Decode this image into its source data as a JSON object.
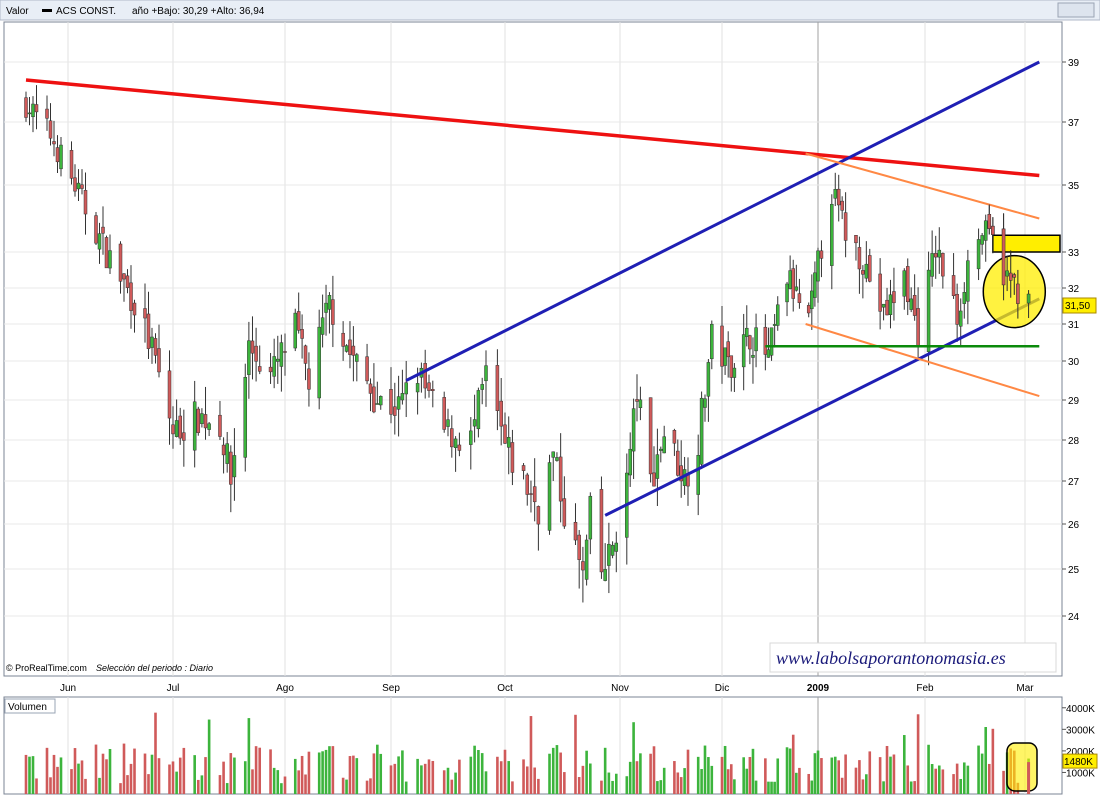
{
  "header": {
    "label": "Valor",
    "ticker": "ACS CONST.",
    "range_text": "año +Bajo: 30,29 +Alto: 36,94"
  },
  "footer": {
    "credit": "© ProRealTime.com",
    "period": "Selección del periodo : Diario",
    "watermark": "www.labolsaporantonomasia.es"
  },
  "volume_panel": {
    "label": "Volumen",
    "yticks": [
      "4000K",
      "3000K",
      "2000K",
      "1000K"
    ],
    "last_label": "1480K"
  },
  "colors": {
    "up": "#3cb43c",
    "down": "#d05a5a",
    "resistance": "#ee1111",
    "channel": "#1f1fb4",
    "fan": "#ff8844",
    "support": "#0b8a0b",
    "highlight": "#ffee00"
  },
  "chart_data": {
    "type": "candlestick",
    "title": "ACS CONST.",
    "x_months": [
      "Jun",
      "Jul",
      "Ago",
      "Sep",
      "Oct",
      "Nov",
      "Dic",
      "2009",
      "Feb",
      "Mar"
    ],
    "y_ticks": [
      24,
      25,
      26,
      27,
      28,
      29,
      30,
      31,
      32,
      33,
      35,
      37,
      39
    ],
    "ylim": [
      23,
      40
    ],
    "last_price": "31,50",
    "period": "daily",
    "range_low": 30.29,
    "range_high": 36.94,
    "trendlines": [
      {
        "kind": "resistance",
        "from": [
          "2008-05-20",
          38.4
        ],
        "to": [
          "2009-03-05",
          35.3
        ]
      },
      {
        "kind": "channel-upper",
        "from": [
          "2008-09-05",
          29.5
        ],
        "to": [
          "2009-03-05",
          39.0
        ]
      },
      {
        "kind": "channel-lower",
        "from": [
          "2008-10-28",
          26.2
        ],
        "to": [
          "2009-03-05",
          31.7
        ]
      },
      {
        "kind": "fan-upper",
        "from": [
          "2008-12-28",
          36.0
        ],
        "to": [
          "2009-03-05",
          34.0
        ]
      },
      {
        "kind": "fan-lower",
        "from": [
          "2008-12-28",
          31.0
        ],
        "to": [
          "2009-03-05",
          29.1
        ]
      },
      {
        "kind": "support",
        "from": [
          "2008-12-15",
          30.4
        ],
        "to": [
          "2009-03-05",
          30.4
        ]
      }
    ],
    "highlight_box": [
      33.0,
      33.5
    ],
    "volume_ylim": [
      0,
      4500
    ]
  }
}
